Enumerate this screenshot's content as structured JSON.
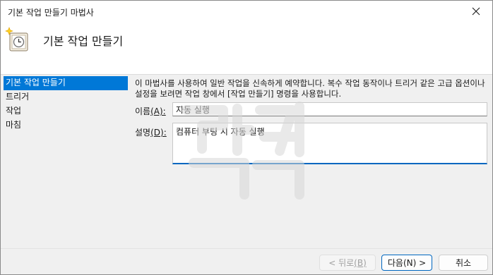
{
  "window": {
    "title": "기본 작업 만들기 마법사"
  },
  "header": {
    "title": "기본 작업 만들기"
  },
  "steps": [
    {
      "label": "기본 작업 만들기",
      "active": true
    },
    {
      "label": "트리거",
      "active": false
    },
    {
      "label": "작업",
      "active": false
    },
    {
      "label": "마침",
      "active": false
    }
  ],
  "main": {
    "description": "이 마법사를 사용하여 일반 작업을 신속하게 예약합니다. 복수 작업 동작이나 트리거 같은 고급 옵션이나 설정을 보려면 작업 창에서 [작업 만들기] 명령을 사용합니다.",
    "name_label": "이름",
    "name_accel": "(A):",
    "name_value": "자동 실행",
    "desc_label": "설명",
    "desc_accel": "(D):",
    "desc_value": "컴퓨터 부팅 시 자동 실행"
  },
  "buttons": {
    "back_label": "< 뒤로",
    "back_accel": "(B)",
    "next_label": "다음",
    "next_accel": "(N) >",
    "cancel_label": "취소"
  },
  "colors": {
    "accent": "#0078d7",
    "focus_border": "#0067c0",
    "watermark": "#d8d8d8"
  }
}
